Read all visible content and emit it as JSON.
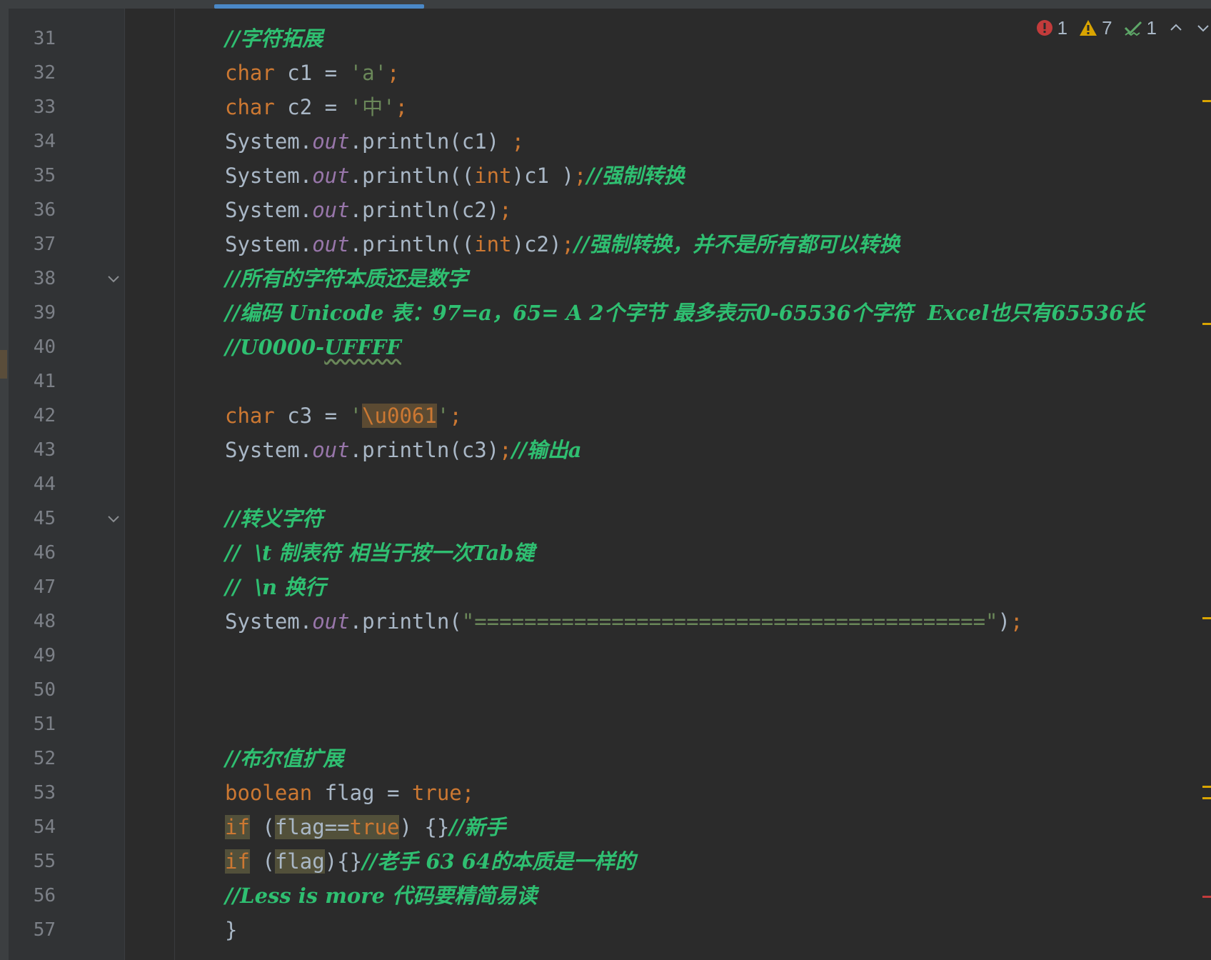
{
  "inspection": {
    "errors": "1",
    "warnings": "7",
    "weak_warnings": "1",
    "colors": {
      "error": "#c23b3b",
      "warning": "#d9a400",
      "ok": "#5ea768"
    }
  },
  "lines": [
    {
      "num": "31",
      "fold": false,
      "tokens": [
        {
          "t": "//字符拓展",
          "c": "cm"
        }
      ]
    },
    {
      "num": "32",
      "fold": false,
      "tokens": [
        {
          "t": "char",
          "c": "kw"
        },
        {
          "t": " c1 = "
        },
        {
          "t": "'a'",
          "c": "str"
        },
        {
          "t": ";",
          "c": "kw"
        }
      ]
    },
    {
      "num": "33",
      "fold": false,
      "tokens": [
        {
          "t": "char",
          "c": "kw"
        },
        {
          "t": " c2 = "
        },
        {
          "t": "'中'",
          "c": "str"
        },
        {
          "t": ";",
          "c": "kw"
        }
      ]
    },
    {
      "num": "34",
      "fold": false,
      "tokens": [
        {
          "t": "System."
        },
        {
          "t": "out",
          "c": "fld"
        },
        {
          "t": ".println(c1) "
        },
        {
          "t": ";",
          "c": "kw"
        }
      ]
    },
    {
      "num": "35",
      "fold": false,
      "tokens": [
        {
          "t": "System."
        },
        {
          "t": "out",
          "c": "fld"
        },
        {
          "t": ".println(("
        },
        {
          "t": "int",
          "c": "kw"
        },
        {
          "t": ")c1 )"
        },
        {
          "t": ";",
          "c": "kw"
        },
        {
          "t": "//强制转换",
          "c": "cm"
        }
      ]
    },
    {
      "num": "36",
      "fold": false,
      "tokens": [
        {
          "t": "System."
        },
        {
          "t": "out",
          "c": "fld"
        },
        {
          "t": ".println(c2)"
        },
        {
          "t": ";",
          "c": "kw"
        }
      ]
    },
    {
      "num": "37",
      "fold": false,
      "tokens": [
        {
          "t": "System."
        },
        {
          "t": "out",
          "c": "fld"
        },
        {
          "t": ".println(("
        },
        {
          "t": "int",
          "c": "kw"
        },
        {
          "t": ")c2)"
        },
        {
          "t": ";",
          "c": "kw"
        },
        {
          "t": "//强制转换，并不是所有都可以转换",
          "c": "cm"
        }
      ]
    },
    {
      "num": "38",
      "fold": true,
      "tokens": [
        {
          "t": "//所有的字符本质还是数字",
          "c": "cm"
        }
      ]
    },
    {
      "num": "39",
      "fold": false,
      "tokens": [
        {
          "t": "//编码 Unicode 表：97=a，65= A 2个字节 最多表示0-65536个字符  Excel也只有65536长",
          "c": "cm"
        }
      ]
    },
    {
      "num": "40",
      "fold": false,
      "tokens": [
        {
          "t": "//U0000-",
          "c": "cm"
        },
        {
          "t": "UFFFF",
          "c": "cm squig"
        }
      ]
    },
    {
      "num": "41",
      "fold": false,
      "tokens": []
    },
    {
      "num": "42",
      "fold": false,
      "tokens": [
        {
          "t": "char",
          "c": "kw"
        },
        {
          "t": " c3 = "
        },
        {
          "t": "'",
          "c": "str"
        },
        {
          "t": "\\u0061",
          "c": "strhl"
        },
        {
          "t": "'",
          "c": "str"
        },
        {
          "t": ";",
          "c": "kw"
        }
      ]
    },
    {
      "num": "43",
      "fold": false,
      "tokens": [
        {
          "t": "System."
        },
        {
          "t": "out",
          "c": "fld"
        },
        {
          "t": ".println(c3)"
        },
        {
          "t": ";",
          "c": "kw"
        },
        {
          "t": "//输出a",
          "c": "cm"
        }
      ]
    },
    {
      "num": "44",
      "fold": false,
      "tokens": []
    },
    {
      "num": "45",
      "fold": true,
      "tokens": [
        {
          "t": "//转义字符",
          "c": "cm"
        }
      ]
    },
    {
      "num": "46",
      "fold": false,
      "tokens": [
        {
          "t": "//  \\t 制表符 相当于按一次Tab键",
          "c": "cm"
        }
      ]
    },
    {
      "num": "47",
      "fold": false,
      "tokens": [
        {
          "t": "//  \\n 换行",
          "c": "cm"
        }
      ]
    },
    {
      "num": "48",
      "fold": false,
      "tokens": [
        {
          "t": "System."
        },
        {
          "t": "out",
          "c": "fld"
        },
        {
          "t": ".println("
        },
        {
          "t": "\"=========================================\"",
          "c": "str"
        },
        {
          "t": ")"
        },
        {
          "t": ";",
          "c": "kw"
        }
      ]
    },
    {
      "num": "49",
      "fold": false,
      "tokens": []
    },
    {
      "num": "50",
      "fold": false,
      "tokens": []
    },
    {
      "num": "51",
      "fold": false,
      "tokens": []
    },
    {
      "num": "52",
      "fold": false,
      "tokens": [
        {
          "t": "//布尔值扩展",
          "c": "cm"
        }
      ]
    },
    {
      "num": "53",
      "fold": false,
      "tokens": [
        {
          "t": "boolean",
          "c": "kw"
        },
        {
          "t": " flag = "
        },
        {
          "t": "true",
          "c": "kw"
        },
        {
          "t": ";",
          "c": "kw"
        }
      ]
    },
    {
      "num": "54",
      "fold": false,
      "tokens": [
        {
          "t": "if",
          "c": "kw hl"
        },
        {
          "t": " ("
        },
        {
          "t": "flag==",
          "c": "hl"
        },
        {
          "t": "true",
          "c": "kw hl"
        },
        {
          "t": ") {}"
        },
        {
          "t": "//新手",
          "c": "cm"
        }
      ]
    },
    {
      "num": "55",
      "fold": false,
      "tokens": [
        {
          "t": "if",
          "c": "kw hl"
        },
        {
          "t": " ("
        },
        {
          "t": "flag",
          "c": "hl"
        },
        {
          "t": "){}"
        },
        {
          "t": "//老手 63 64的本质是一样的",
          "c": "cm"
        }
      ]
    },
    {
      "num": "56",
      "fold": false,
      "tokens": [
        {
          "t": "//Less is more 代码要精简易读",
          "c": "cm"
        }
      ]
    },
    {
      "num": "57",
      "fold": false,
      "tokens": [
        {
          "t": "}"
        }
      ]
    }
  ]
}
